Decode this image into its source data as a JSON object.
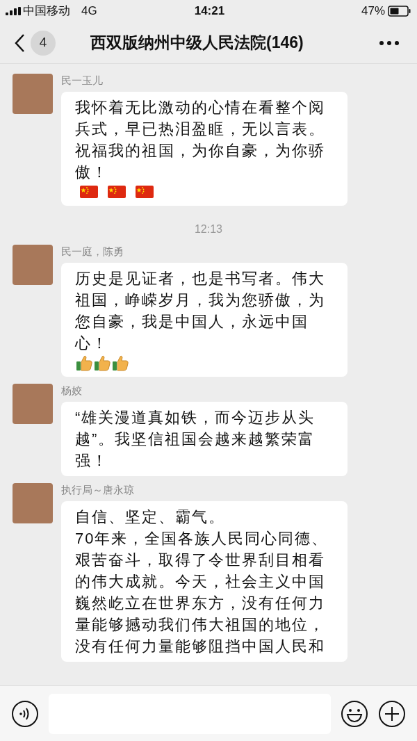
{
  "status_bar": {
    "carrier": "中国移动",
    "network": "4G",
    "time": "14:21",
    "battery": "47%"
  },
  "header": {
    "back_count": "4",
    "title": "西双版纳州中级人民法院(146)"
  },
  "messages": [
    {
      "kind": "message",
      "sender": "民一玉儿",
      "text": "我怀着无比激动的心情在看整个阅兵式，早已热泪盈眶，无以言表。祝福我的祖国，为你自豪，为你骄傲！",
      "emojis": [
        {
          "kind": "flag"
        },
        {
          "kind": "flag"
        },
        {
          "kind": "flag"
        }
      ]
    },
    {
      "kind": "time",
      "text": "12:13"
    },
    {
      "kind": "message",
      "sender": "民一庭，陈勇",
      "text": "历史是见证者，也是书写者。伟大祖国，峥嵘岁月，我为您骄傲，为您自豪，我是中国人，永远中国心！",
      "emojis": [
        {
          "kind": "thumbs_up"
        },
        {
          "kind": "thumbs_up"
        },
        {
          "kind": "thumbs_up"
        }
      ]
    },
    {
      "kind": "message",
      "sender": "杨姣",
      "text": "“雄关漫道真如铁，而今迈步从头越”。我坚信祖国会越来越繁荣富强！"
    },
    {
      "kind": "message",
      "sender": "执行局～唐永琼",
      "text": "自信、坚定、霸气。\n70年来，全国各族人民同心同德、艰苦奋斗，取得了令世界刮目相看的伟大成就。今天，社会主义中国巍然屹立在世界东方，没有任何力量能够撼动我们伟大祖国的地位，没有任何力量能够阻挡中国人民和"
    }
  ]
}
